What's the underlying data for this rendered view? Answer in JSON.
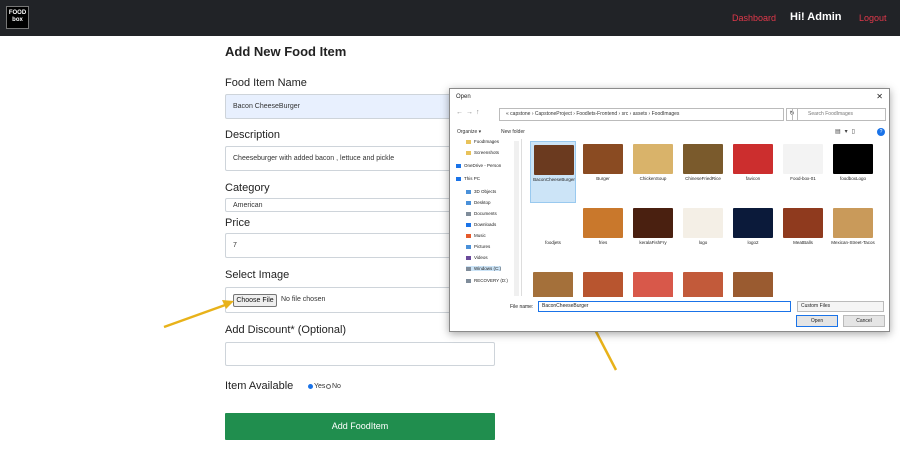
{
  "navbar": {
    "logo_text": "FOOD box",
    "dashboard": "Dashboard",
    "greeting": "Hi! Admin",
    "logout": "Logout"
  },
  "form": {
    "title": "Add New Food Item",
    "name_label": "Food Item Name",
    "name_value": "Bacon CheeseBurger",
    "description_label": "Description",
    "description_value": "Cheeseburger with added bacon , lettuce and pickle",
    "category_label": "Category",
    "category_value": "American",
    "price_label": "Price",
    "price_value": "7",
    "image_label": "Select Image",
    "choose_file": "Choose File",
    "no_file": "No file chosen",
    "discount_label": "Add Discount* (Optional)",
    "discount_value": "",
    "available_label": "Item Available",
    "yes": "Yes",
    "no": "No",
    "submit": "Add FoodItem"
  },
  "dialog": {
    "title": "Open",
    "address": "« capstone › CapstoneProject › Foodlets-Frontend › src › assets › FoodImages",
    "search_placeholder": "Search FoodImages",
    "organize": "Organize ▾",
    "new_folder": "New folder",
    "nav_items": [
      "FoodImages",
      "Screenshots",
      "OneDrive - Person",
      "This PC",
      "3D Objects",
      "Desktop",
      "Documents",
      "Downloads",
      "Music",
      "Pictures",
      "Videos",
      "Windows (C:)",
      "RECOVERY (D:)"
    ],
    "files": [
      {
        "name": "BaconCheeseBurger",
        "color": "#6b3a1f"
      },
      {
        "name": "Burger",
        "color": "#8a4b22"
      },
      {
        "name": "ChickenSoup",
        "color": "#d9b36a"
      },
      {
        "name": "ChineseFriedRice",
        "color": "#7a5a2c"
      },
      {
        "name": "favicon",
        "color": "#cc2e2e"
      },
      {
        "name": "Food-box-01",
        "color": "#f3f3f3"
      },
      {
        "name": "foodboxLogo",
        "color": "#000000"
      },
      {
        "name": "foodjets",
        "color": "#ffffff"
      },
      {
        "name": "fries",
        "color": "#c9782c"
      },
      {
        "name": "keralaFishFry",
        "color": "#4a2010"
      },
      {
        "name": "logo",
        "color": "#f4efe6"
      },
      {
        "name": "logo2",
        "color": "#0b1a3a"
      },
      {
        "name": "MeatBalls",
        "color": "#8f3a1e"
      },
      {
        "name": "Mexican-Street-Tacos",
        "color": "#c99a5a"
      },
      {
        "name": "",
        "color": "#a4703a"
      },
      {
        "name": "",
        "color": "#b8552f"
      },
      {
        "name": "",
        "color": "#d8584a"
      },
      {
        "name": "",
        "color": "#c25a3a"
      },
      {
        "name": "",
        "color": "#9a5b30"
      }
    ],
    "file_name_label": "File name:",
    "file_name_value": "BaconCheeseBurger",
    "file_type": "Custom Files",
    "open": "Open",
    "cancel": "Cancel"
  },
  "colors": {
    "navbar": "#212327",
    "accent_red": "#e0384a",
    "submit_green": "#208e4e",
    "arrow": "#e8b21a"
  }
}
